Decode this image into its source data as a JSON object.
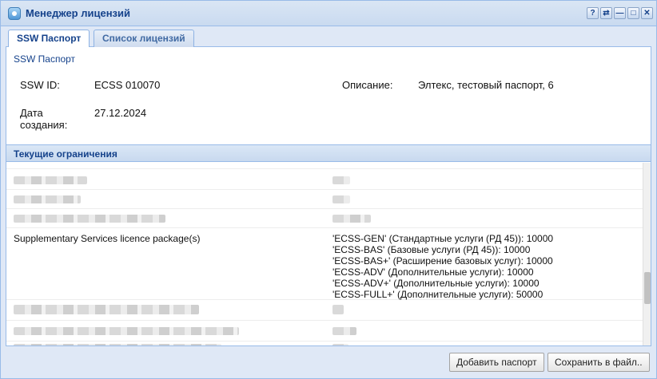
{
  "window": {
    "title": "Менеджер лицензий",
    "tools": [
      "?",
      "⇄",
      "—",
      "□",
      "✕"
    ]
  },
  "tabs": [
    {
      "label": "SSW Паспорт",
      "active": true
    },
    {
      "label": "Список лицензий",
      "active": false
    }
  ],
  "passport": {
    "heading": "SSW Паспорт",
    "ssw_id_label": "SSW ID:",
    "ssw_id_value": "ECSS 010070",
    "description_label": "Описание:",
    "description_value": "Элтекс, тестовый паспорт, 6",
    "created_label_line1": "Дата",
    "created_label_line2": "создания:",
    "created_value": "27.12.2024"
  },
  "restrictions": {
    "header": "Текущие ограничения",
    "rows": [
      {
        "name": "",
        "values": [],
        "redacted": true
      },
      {
        "name": "",
        "values": [],
        "redacted": true
      },
      {
        "name": "",
        "values": [],
        "redacted": true
      },
      {
        "name": "",
        "values": [],
        "redacted": true
      },
      {
        "name": "Supplementary Services licence package(s)",
        "values": [
          "'ECSS-GEN' (Стандартные услуги (РД 45)): 10000",
          "'ECSS-BAS' (Базовые услуги (РД 45)): 10000",
          "'ECSS-BAS+' (Расширение базовых услуг): 10000",
          "'ECSS-ADV' (Дополнительные услуги): 10000",
          "'ECSS-ADV+' (Дополнительные услуги): 10000",
          "'ECSS-FULL+' (Дополнительные услуги): 50000"
        ],
        "redacted": false
      },
      {
        "name": "",
        "values": [],
        "redacted": true
      },
      {
        "name": "",
        "values": [],
        "redacted": true
      },
      {
        "name": "",
        "values": [],
        "redacted": true
      }
    ]
  },
  "buttons": {
    "add_passport": "Добавить паспорт",
    "save_to_file": "Сохранить в файл.."
  }
}
